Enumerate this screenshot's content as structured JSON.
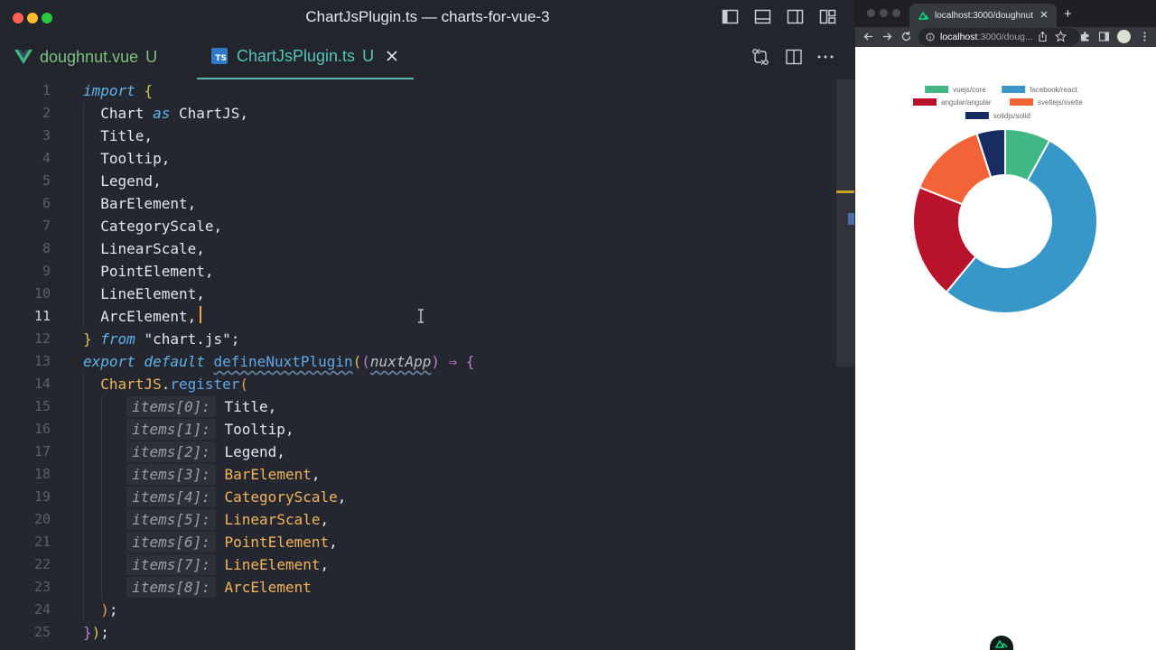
{
  "editor": {
    "window_title": "ChartJsPlugin.ts — charts-for-vue-3",
    "tabs": [
      {
        "name": "doughnut.vue",
        "status": "U",
        "active": false
      },
      {
        "name": "ChartJsPlugin.ts",
        "status": "U",
        "active": true
      }
    ],
    "ts_badge": "TS",
    "active_line": 11
  },
  "browser": {
    "tab_title": "localhost:3000/doughnut",
    "new_tab": "+",
    "url_host": "localhost",
    "url_path": ":3000/doug..."
  },
  "chart_data": {
    "type": "pie",
    "variant": "doughnut",
    "categories": [
      "vuejs/core",
      "facebook/react",
      "angular/angular",
      "sveltejs/svelte",
      "solidjs/solid"
    ],
    "values": [
      8,
      53,
      20,
      14,
      5
    ],
    "colors": [
      "#41b883",
      "#3897c9",
      "#b8132b",
      "#f26438",
      "#172c63"
    ],
    "legend": "top"
  }
}
